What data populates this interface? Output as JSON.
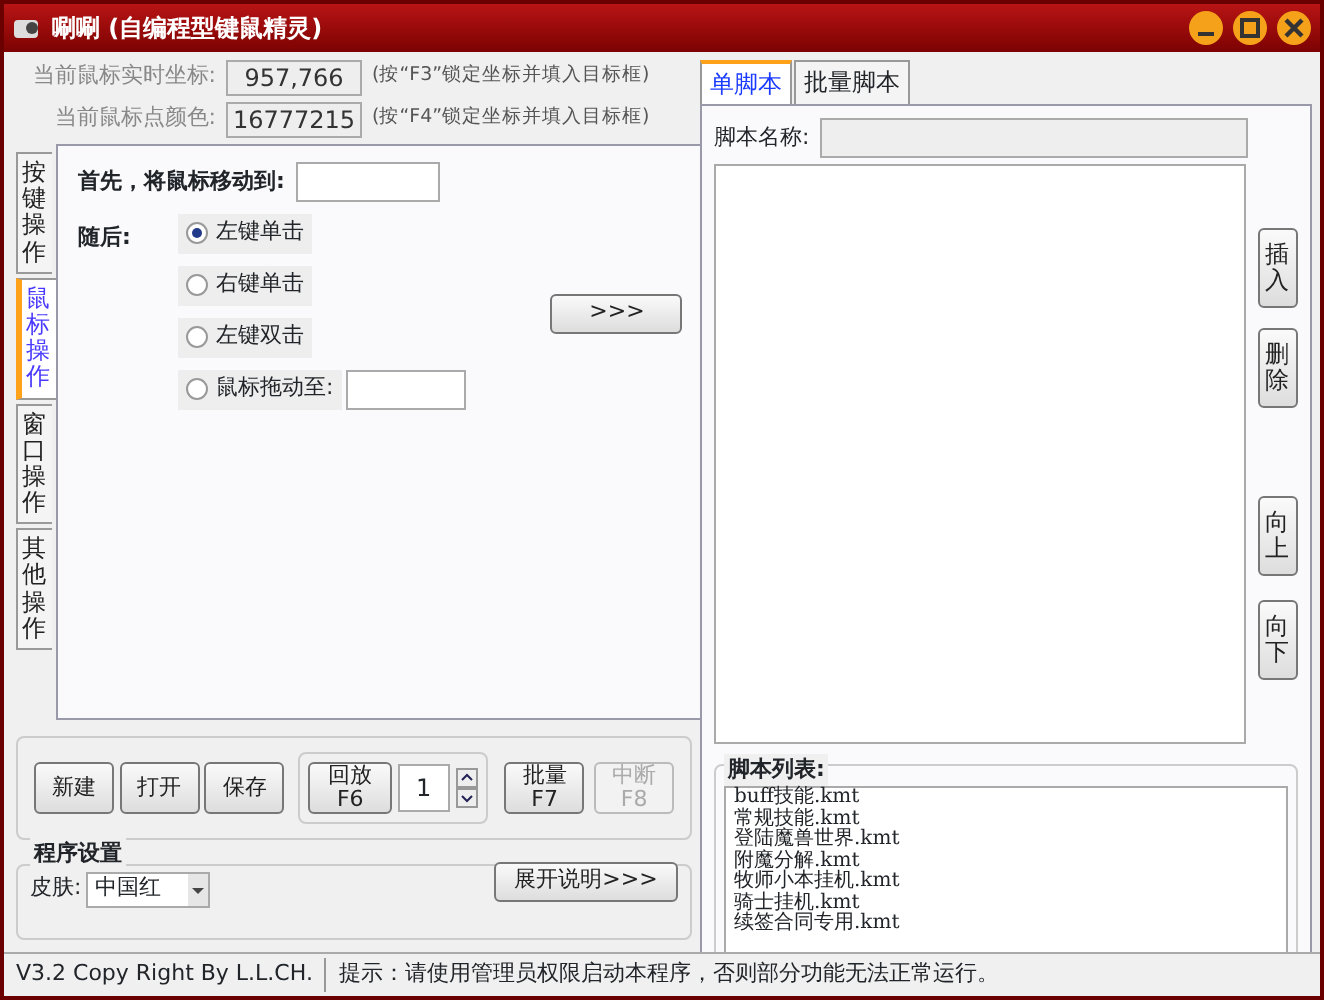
{
  "window": {
    "title": "唰唰 (自编程型键鼠精灵)"
  },
  "readouts": [
    {
      "label": "当前鼠标实时坐标:",
      "value": "957,766",
      "hint": "(按“F3”锁定坐标并填入目标框)"
    },
    {
      "label": "当前鼠标点颜色:",
      "value": "16777215",
      "hint": "(按“F4”锁定坐标并填入目标框)"
    }
  ],
  "left_tabs": [
    {
      "label": "按键操作",
      "selected": false
    },
    {
      "label": "鼠标操作",
      "selected": true
    },
    {
      "label": "窗口操作",
      "selected": false
    },
    {
      "label": "其他操作",
      "selected": false
    }
  ],
  "mouse_panel": {
    "move_label": "首先，将鼠标移动到:",
    "then_label": "随后:",
    "add_button": ">>>",
    "options": [
      {
        "label": "左键单击",
        "selected": true,
        "kind": "plain"
      },
      {
        "label": "右键单击",
        "selected": false,
        "kind": "plain"
      },
      {
        "label": "左键双击",
        "selected": false,
        "kind": "plain"
      },
      {
        "label": "鼠标拖动至:",
        "selected": false,
        "kind": "field"
      }
    ]
  },
  "file_buttons": [
    {
      "label": "新建"
    },
    {
      "label": "打开"
    },
    {
      "label": "保存"
    }
  ],
  "replay": {
    "label": "回放",
    "key": "F6",
    "count": "1"
  },
  "run_buttons": [
    {
      "label": "批量",
      "key": "F7",
      "disabled": false
    },
    {
      "label": "中断",
      "key": "F8",
      "disabled": true
    }
  ],
  "settings": {
    "title": "程序设置",
    "skin_label": "皮肤:",
    "skin": "中国红",
    "help_button": "展开说明>>>"
  },
  "right_tabs": [
    {
      "label": "单脚本",
      "selected": true
    },
    {
      "label": "批量脚本",
      "selected": false
    }
  ],
  "script_name_label": "脚本名称:",
  "side_buttons": [
    "插入",
    "删除",
    "向上",
    "向下"
  ],
  "script_list": {
    "title": "脚本列表:",
    "items": [
      "buff技能.kmt",
      "常规技能.kmt",
      "登陆魔兽世界.kmt",
      "附魔分解.kmt",
      "牧师小本挂机.kmt",
      "骑士挂机.kmt",
      "续签合同专用.kmt"
    ]
  },
  "status_bar": {
    "version": "V3.2 Copy Right By L.L.CH.",
    "hint": "提示：请使用管理员权限启动本程序，否则部分功能无法正常运行。"
  }
}
